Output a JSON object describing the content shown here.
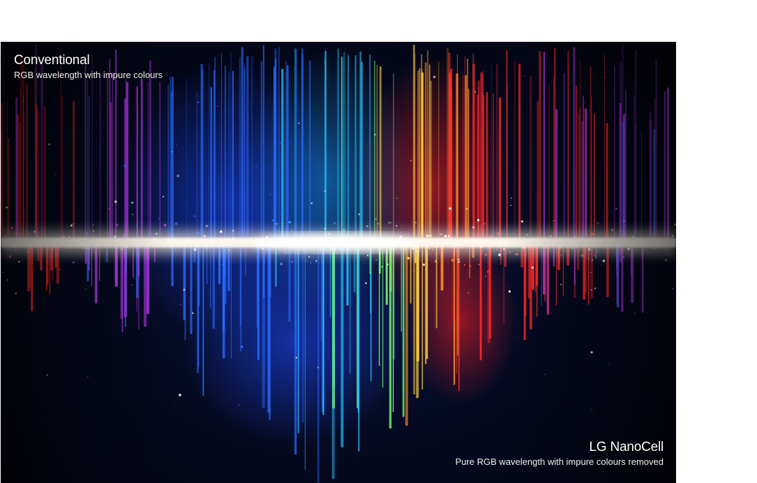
{
  "conventional": {
    "title": "Conventional",
    "subtitle": "RGB wavelength with impure colours"
  },
  "nanocell": {
    "title": "LG NanoCell",
    "subtitle": "Pure RGB wavelength with impure colours removed"
  },
  "palette": {
    "blue": "#2a6bff",
    "cyan": "#27c4ff",
    "green": "#7dff7a",
    "yellow": "#ffd23a",
    "orange": "#ff8a1f",
    "red": "#ff2a2a",
    "magenta": "#c23cff",
    "glow": "#fff6e8",
    "background": "#02030c"
  }
}
